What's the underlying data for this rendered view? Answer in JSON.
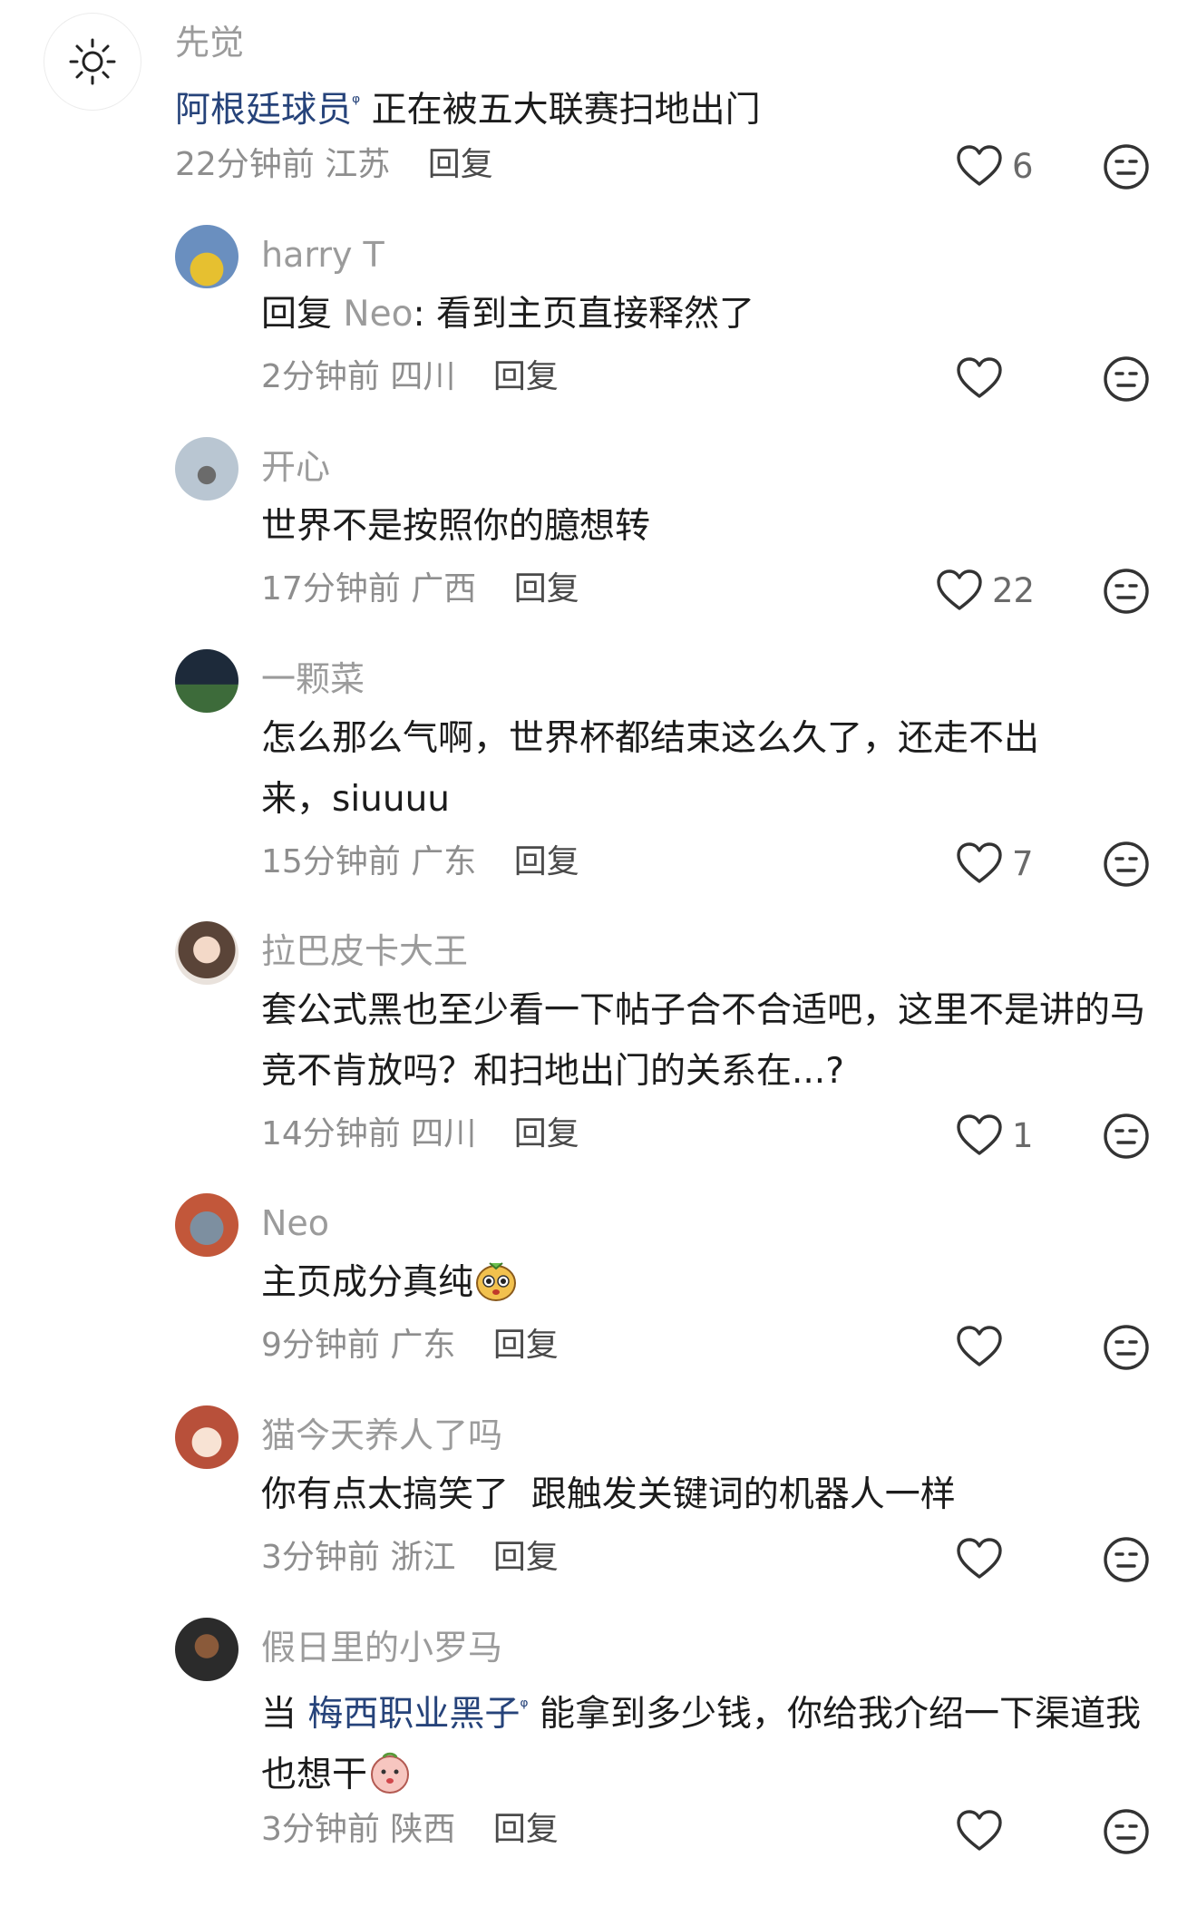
{
  "comments": [
    {
      "username": "先觉",
      "text_link": "阿根廷球员",
      "text": "正在被五大联赛扫地出门",
      "time": "22分钟前",
      "location": "江苏",
      "reply_label": "回复",
      "likes": "6"
    },
    {
      "username": "harry T",
      "reply_prefix": "回复",
      "reply_to": "Neo",
      "text": ": 看到主页直接释然了",
      "time": "2分钟前",
      "location": "四川",
      "reply_label": "回复",
      "likes": ""
    },
    {
      "username": "开心",
      "text": "世界不是按照你的臆想转",
      "time": "17分钟前",
      "location": "广西",
      "reply_label": "回复",
      "likes": "22"
    },
    {
      "username": "一颗菜",
      "text": "怎么那么气啊，世界杯都结束这么久了，还走不出来，siuuuu",
      "time": "15分钟前",
      "location": "广东",
      "reply_label": "回复",
      "likes": "7"
    },
    {
      "username": "拉巴皮卡大王",
      "text": "套公式黑也至少看一下帖子合不合适吧，这里不是讲的马竞不肯放吗？和扫地出门的关系在...?",
      "time": "14分钟前",
      "location": "四川",
      "reply_label": "回复",
      "likes": "1"
    },
    {
      "username": "Neo",
      "text": "主页成分真纯",
      "time": "9分钟前",
      "location": "广东",
      "reply_label": "回复",
      "likes": ""
    },
    {
      "username": "猫今天养人了吗",
      "text": "你有点太搞笑了  跟触发关键词的机器人一样",
      "time": "3分钟前",
      "location": "浙江",
      "reply_label": "回复",
      "likes": ""
    },
    {
      "username": "假日里的小罗马",
      "text_pre": "当 ",
      "text_link": "梅西职业黑子",
      "text": "能拿到多少钱，你给我介绍一下渠道我也想干",
      "time": "3分钟前",
      "location": "陕西",
      "reply_label": "回复",
      "likes": ""
    }
  ],
  "icons": {
    "like": "heart-outline-icon",
    "dislike": "neutral-face-icon",
    "search": "search-icon"
  },
  "colors": {
    "link": "#26437a",
    "username": "#9b9b9b",
    "meta": "#8e8e8e"
  }
}
